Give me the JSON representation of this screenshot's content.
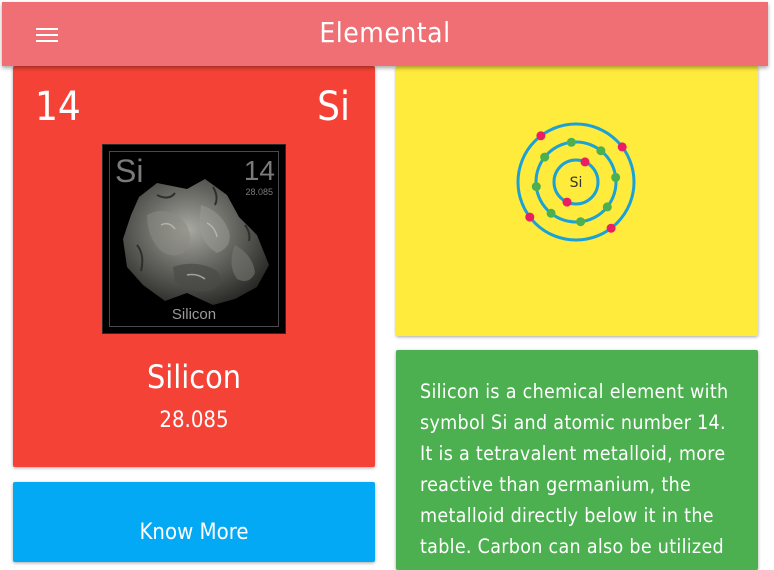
{
  "app": {
    "title": "Elemental",
    "menu_icon": "hamburger-menu-icon"
  },
  "element": {
    "atomic_number": "14",
    "symbol": "Si",
    "name": "Silicon",
    "atomic_mass": "28.085",
    "card_color": "#f44336"
  },
  "element_image": {
    "symbol": "Si",
    "atomic_number": "14",
    "atomic_mass": "28.085",
    "name": "Silicon"
  },
  "know_more": {
    "label": "Know More",
    "color": "#03a9f4"
  },
  "bohr_model": {
    "nucleus_label": "Si",
    "shells": [
      2,
      8,
      4
    ],
    "background": "#ffeb3b",
    "orbit_color": "#1ba1d6",
    "electron_colors": [
      "#e91e63",
      "#4caf50"
    ]
  },
  "description": {
    "text": "Silicon is a chemical element with symbol Si and atomic number 14. It is a tetravalent metalloid, more reactive than germanium, the metalloid directly below it in the table. Carbon can also be utilized",
    "color": "#4caf50"
  },
  "colors": {
    "app_bar": "#ef6f74"
  }
}
